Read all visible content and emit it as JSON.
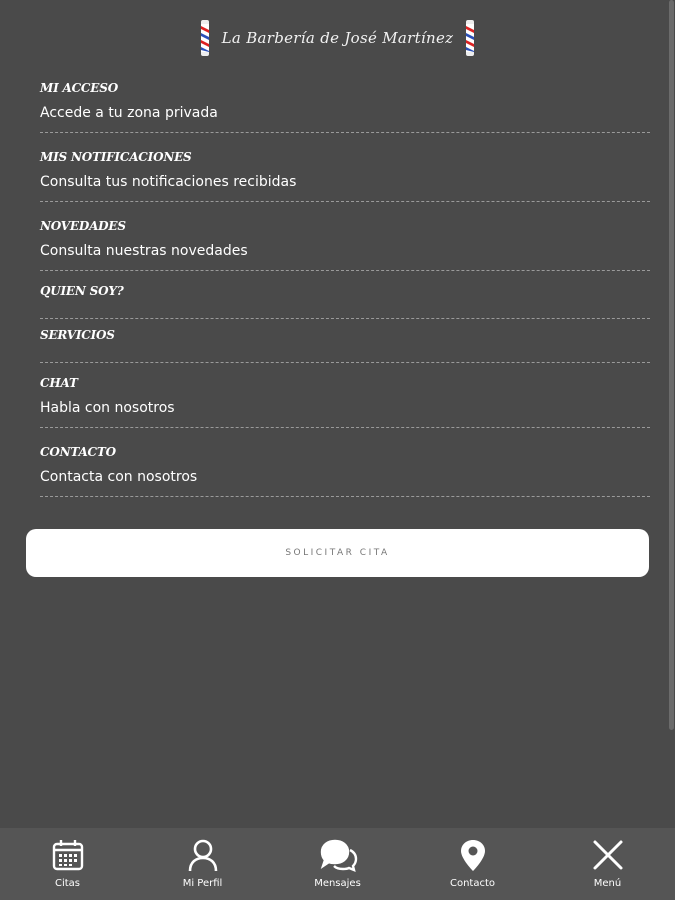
{
  "header": {
    "title": "La Barbería de José Martínez"
  },
  "menu": {
    "items": [
      {
        "title": "MI ACCESO",
        "subtitle": "Accede a tu zona privada"
      },
      {
        "title": "MIS NOTIFICACIONES",
        "subtitle": "Consulta tus notificaciones recibidas"
      },
      {
        "title": "NOVEDADES",
        "subtitle": "Consulta nuestras novedades"
      },
      {
        "title": "QUIEN SOY?"
      },
      {
        "title": "SERVICIOS"
      },
      {
        "title": "CHAT",
        "subtitle": "Habla con nosotros"
      },
      {
        "title": "CONTACTO",
        "subtitle": "Contacta con nosotros"
      }
    ]
  },
  "cta": {
    "label": "SOLICITAR CITA"
  },
  "tabbar": {
    "tabs": [
      {
        "label": "Citas",
        "icon": "calendar-icon"
      },
      {
        "label": "Mi Perfil",
        "icon": "user-icon"
      },
      {
        "label": "Mensajes",
        "icon": "chat-bubbles-icon"
      },
      {
        "label": "Contacto",
        "icon": "map-pin-icon"
      },
      {
        "label": "Menú",
        "icon": "close-icon"
      }
    ]
  },
  "colors": {
    "background": "#4a4a4a",
    "tabbar": "#555555",
    "button": "#ffffff"
  }
}
